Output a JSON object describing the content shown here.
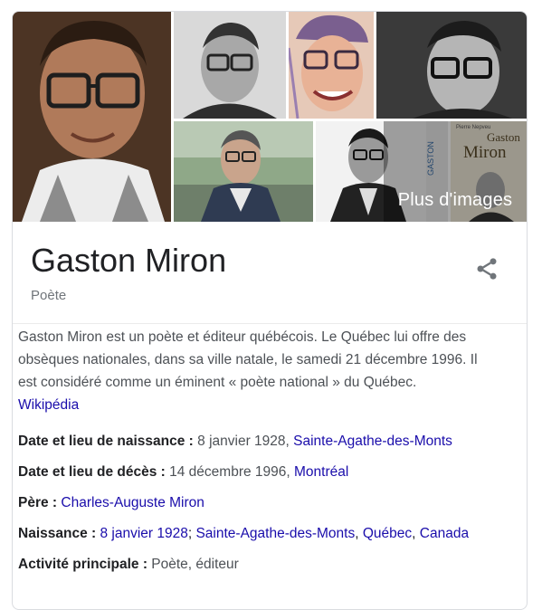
{
  "gallery": {
    "more_images_label": "Plus d'images",
    "images": [
      {
        "name": "portrait-main",
        "alt": "Gaston Miron portrait"
      },
      {
        "name": "portrait-bw-1",
        "alt": "Gaston Miron black and white"
      },
      {
        "name": "portrait-illustration",
        "alt": "Gaston Miron illustration"
      },
      {
        "name": "portrait-bw-2",
        "alt": "Gaston Miron black and white close-up"
      },
      {
        "name": "portrait-street",
        "alt": "Gaston Miron outdoors"
      },
      {
        "name": "portrait-bw-3",
        "alt": "Gaston Miron young"
      },
      {
        "name": "book-cover",
        "alt": "Book cover Gaston Miron"
      }
    ],
    "book_cover": {
      "author_small": "Pierre Nepveu",
      "title_line1": "Gaston",
      "title_line2": "Miron",
      "side_text": "GASTON"
    }
  },
  "header": {
    "title": "Gaston Miron",
    "subtitle": "Poète",
    "share_icon": "share-icon"
  },
  "description": {
    "text": "Gaston Miron est un poète et éditeur québécois. Le Québec lui offre des obsèques nationales, dans sa ville natale, le samedi 21 décembre 1996. Il est considéré comme un éminent « poète national » du Québec.",
    "source_label": "Wikipédia"
  },
  "facts": [
    {
      "label": "Date et lieu de naissance : ",
      "plain": "8 janvier 1928, ",
      "links": [
        "Sainte-Agathe-des-Monts"
      ]
    },
    {
      "label": "Date et lieu de décès : ",
      "plain": "14 décembre 1996, ",
      "links": [
        "Montréal"
      ]
    },
    {
      "label": "Père : ",
      "plain": "",
      "links": [
        "Charles-Auguste Miron"
      ]
    },
    {
      "label": "Naissance : ",
      "plain": "",
      "links": [
        "8 janvier 1928",
        "Sainte-Agathe-des-Monts",
        "Québec",
        "Canada"
      ]
    },
    {
      "label": "Activité principale : ",
      "plain": "Poète, éditeur",
      "links": []
    }
  ],
  "colors": {
    "link": "#1a0dab",
    "text": "#202124",
    "secondary": "#70757a",
    "border": "#dadce0"
  }
}
